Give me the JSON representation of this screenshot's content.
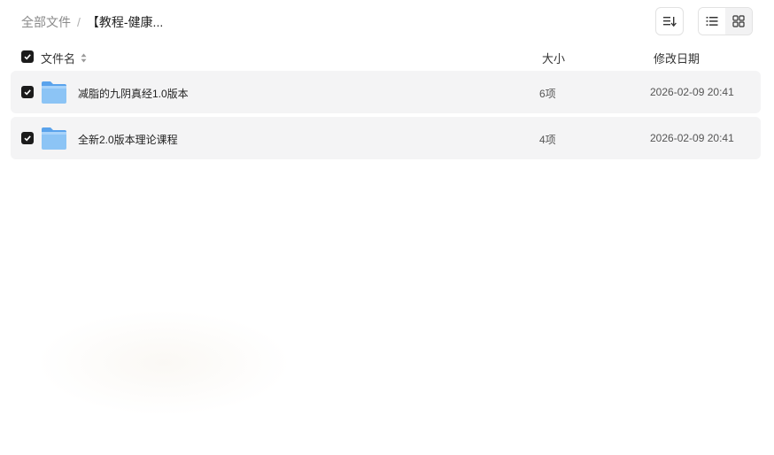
{
  "breadcrumb": {
    "root": "全部文件",
    "separator": "/",
    "current": "【教程-健康..."
  },
  "toolbar": {
    "sort_icon": "sort-lines-icon",
    "view_list_icon": "list-view-icon",
    "view_grid_icon": "grid-view-icon"
  },
  "columns": {
    "name": "文件名",
    "size": "大小",
    "date": "修改日期"
  },
  "files": [
    {
      "name": "减脂的九阴真经1.0版本",
      "size": "6项",
      "date": "2026-02-09 20:41",
      "checked": true
    },
    {
      "name": "全新2.0版本理论课程",
      "size": "4项",
      "date": "2026-02-09 20:41",
      "checked": true
    }
  ],
  "colors": {
    "row_bg": "#f4f4f5",
    "folder": "#7fb8f0",
    "checkbox": "#1b1b1b"
  }
}
